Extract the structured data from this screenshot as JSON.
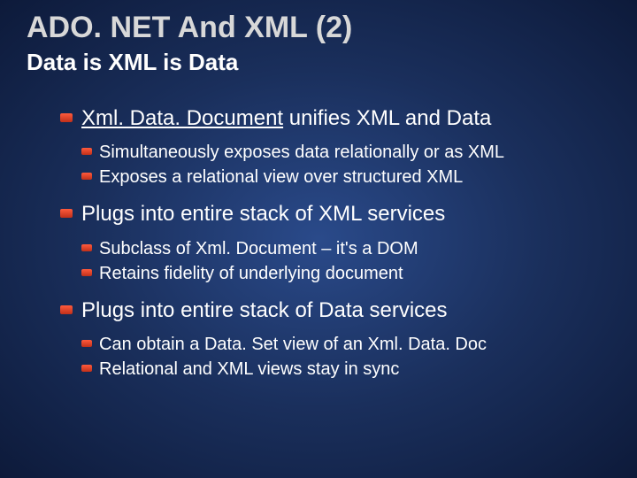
{
  "title": "ADO. NET And XML (2)",
  "subtitle": "Data is XML is Data",
  "bullets": [
    {
      "underlined": "Xml. Data. Document",
      "rest": " unifies XML and Data",
      "subs": [
        "Simultaneously exposes data relationally or as XML",
        "Exposes a relational view over structured XML"
      ]
    },
    {
      "text": "Plugs into entire stack of XML services",
      "subs": [
        "Subclass of Xml. Document – it's a DOM",
        "Retains fidelity of underlying document"
      ]
    },
    {
      "text": "Plugs into entire stack of Data services",
      "subs": [
        "Can obtain a Data. Set view of an Xml. Data. Doc",
        "Relational and XML views stay in sync"
      ]
    }
  ]
}
